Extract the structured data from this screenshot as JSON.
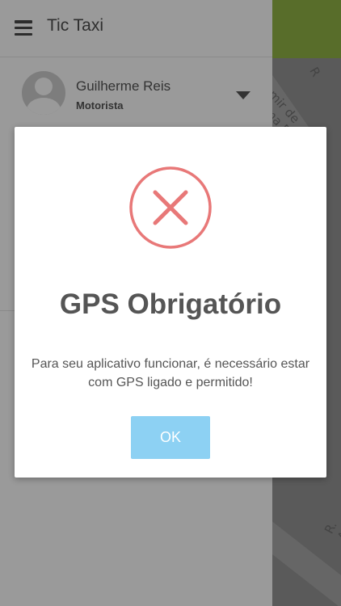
{
  "app": {
    "title": "Tic Taxi"
  },
  "drawer": {
    "menu_icon": "hamburger-menu-icon",
    "user": {
      "name": "Guilherme Reis",
      "role": "Motorista"
    },
    "expand_icon": "caret-down-icon"
  },
  "map": {
    "streets": [
      "mir de Lima P",
      "R",
      "R. Am"
    ]
  },
  "dialog": {
    "icon": "error-x-circle-icon",
    "title": "GPS Obrigatório",
    "message": "Para seu aplicativo funcionar, é necessário estar com GPS ligado e permitido!",
    "ok_label": "OK"
  },
  "colors": {
    "error_icon": "#e87878",
    "ok_button": "#8dd1f3",
    "map_topbar": "#586d2a",
    "overlay": "#9a9a9a"
  }
}
